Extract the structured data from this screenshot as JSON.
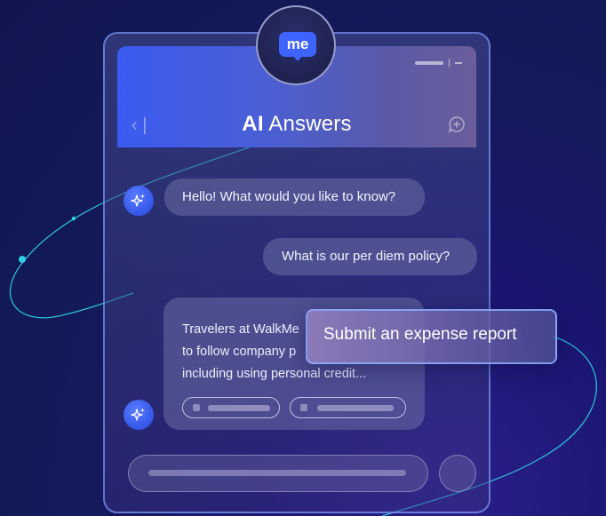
{
  "header": {
    "title_bold": "AI",
    "title_rest": " Answers"
  },
  "logo": {
    "text": "me"
  },
  "messages": {
    "greeting": "Hello! What would you like to know?",
    "user_question": "What is our per diem policy?",
    "answer_lines": [
      "Travelers at WalkMe",
      "to follow company p",
      "including using personal credit..."
    ]
  },
  "suggestion": {
    "label": "Submit an expense report"
  },
  "icons": {
    "back": "chevron-left-icon",
    "new_chat": "new-chat-icon",
    "assistant": "sparkle-icon",
    "logo": "walkme-logo-icon"
  },
  "colors": {
    "accent": "#3e63ff",
    "orbit": "#2fd0e0"
  }
}
